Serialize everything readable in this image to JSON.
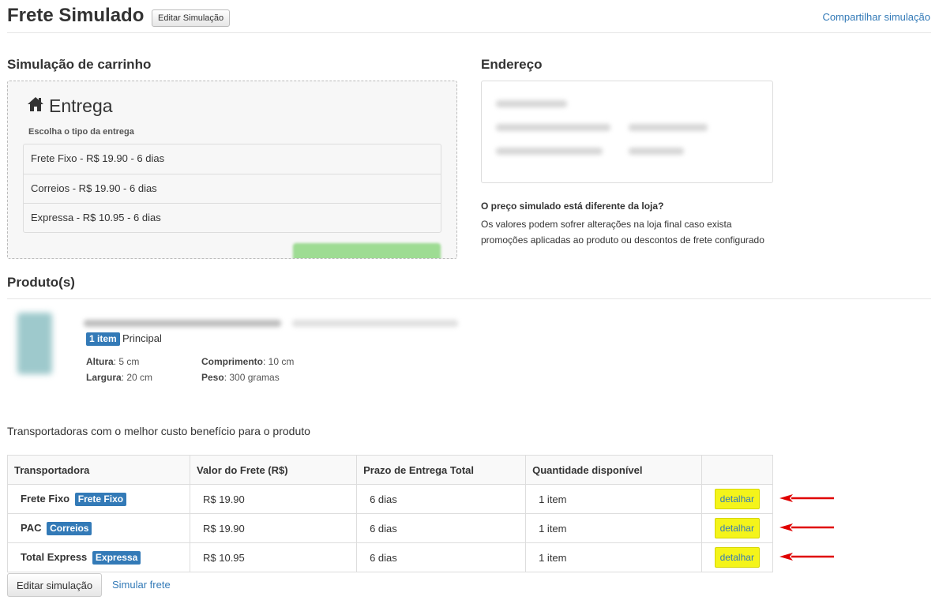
{
  "header": {
    "title": "Frete Simulado",
    "edit_button": "Editar Simulação",
    "share_link": "Compartilhar simulação"
  },
  "cart": {
    "section_title": "Simulação de carrinho",
    "entrega_title": "Entrega",
    "entrega_subtitle": "Escolha o tipo da entrega",
    "options": [
      {
        "label": "Frete Fixo - R$ 19.90 - 6 dias"
      },
      {
        "label": "Correios - R$ 19.90 - 6 dias"
      },
      {
        "label": "Expressa - R$ 10.95 - 6 dias"
      }
    ]
  },
  "address": {
    "section_title": "Endereço"
  },
  "notice": {
    "title": "O preço simulado está diferente da loja?",
    "text": "Os valores podem sofrer alterações na loja final caso exista promoções aplicadas ao produto ou descontos de frete configurado"
  },
  "products": {
    "section_title": "Produto(s)",
    "qty_badge": "1 item",
    "qty_label": "Principal",
    "altura_label": "Altura",
    "altura_value": ": 5 cm",
    "largura_label": "Largura",
    "largura_value": ": 20 cm",
    "comprimento_label": "Comprimento",
    "comprimento_value": ": 10 cm",
    "peso_label": "Peso",
    "peso_value": ": 300 gramas"
  },
  "carriers": {
    "intro": "Transportadoras com o melhor custo benefício para o produto",
    "columns": [
      "Transportadora",
      "Valor do Frete (R$)",
      "Prazo de Entrega Total",
      "Quantidade disponível",
      ""
    ],
    "rows": [
      {
        "name": "Frete Fixo",
        "tag": "Frete Fixo",
        "price": "R$ 19.90",
        "prazo": "6 dias",
        "qty": "1 item",
        "action": "detalhar"
      },
      {
        "name": "PAC",
        "tag": "Correios",
        "price": "R$ 19.90",
        "prazo": "6 dias",
        "qty": "1 item",
        "action": "detalhar"
      },
      {
        "name": "Total Express",
        "tag": "Expressa",
        "price": "R$ 10.95",
        "prazo": "6 dias",
        "qty": "1 item",
        "action": "detalhar"
      }
    ]
  },
  "footer": {
    "edit_button": "Editar simulação",
    "simulate_link": "Simular frete"
  },
  "colors": {
    "link": "#337ab7",
    "badge": "#337ab7",
    "highlight": "#f4f41a",
    "arrow": "#e00000"
  }
}
